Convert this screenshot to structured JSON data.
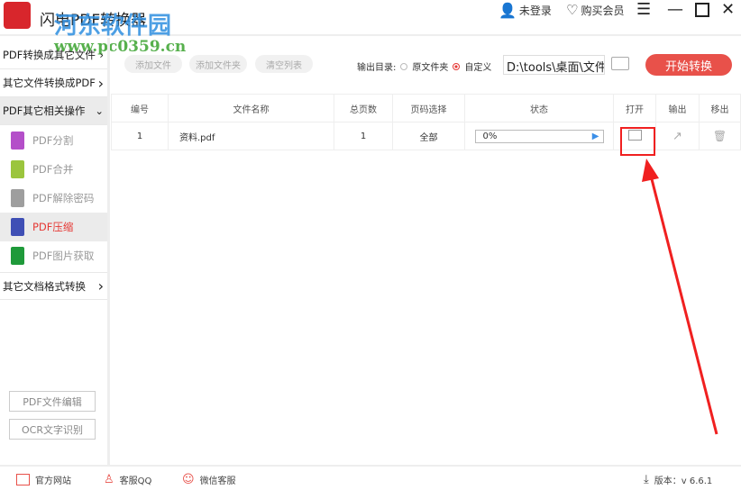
{
  "app": {
    "title": "闪电PDF转换器",
    "watermark_name": "河东软件园",
    "watermark_url": "www.pc0359.cn"
  },
  "topbar": {
    "login": "未登录",
    "vip": "购买会员"
  },
  "sidebar": {
    "sections": [
      "PDF转换成其它文件",
      "其它文件转换成PDF",
      "PDF其它相关操作",
      "其它文档格式转换"
    ],
    "items": [
      {
        "label": "PDF分割",
        "color": "#b44fc9"
      },
      {
        "label": "PDF合并",
        "color": "#9bc53d"
      },
      {
        "label": "PDF解除密码",
        "color": "#9e9e9e"
      },
      {
        "label": "PDF压缩",
        "color": "#3f4fb5"
      },
      {
        "label": "PDF图片获取",
        "color": "#1f9a3a"
      }
    ],
    "bottom_buttons": [
      "PDF文件编辑",
      "OCR文字识别"
    ]
  },
  "toolbar": {
    "add_file": "添加文件",
    "add_folder": "添加文件夹",
    "clear_list": "清空列表",
    "output_label": "输出目录:",
    "opt_source": "原文件夹",
    "opt_custom": "自定义",
    "path": "D:\\tools\\桌面\\文件",
    "start": "开始转换"
  },
  "table": {
    "headers": [
      "编号",
      "文件名称",
      "总页数",
      "页码选择",
      "状态",
      "打开",
      "输出",
      "移出"
    ],
    "rows": [
      {
        "no": "1",
        "name": "资料.pdf",
        "pages": "1",
        "range": "全部",
        "progress": "0%"
      }
    ]
  },
  "footer": {
    "website": "官方网站",
    "qq": "客服QQ",
    "wechat": "微信客服",
    "version": "版本：v 6.6.1"
  },
  "colors": {
    "accent": "#e8514a",
    "selected": "#e53935"
  }
}
